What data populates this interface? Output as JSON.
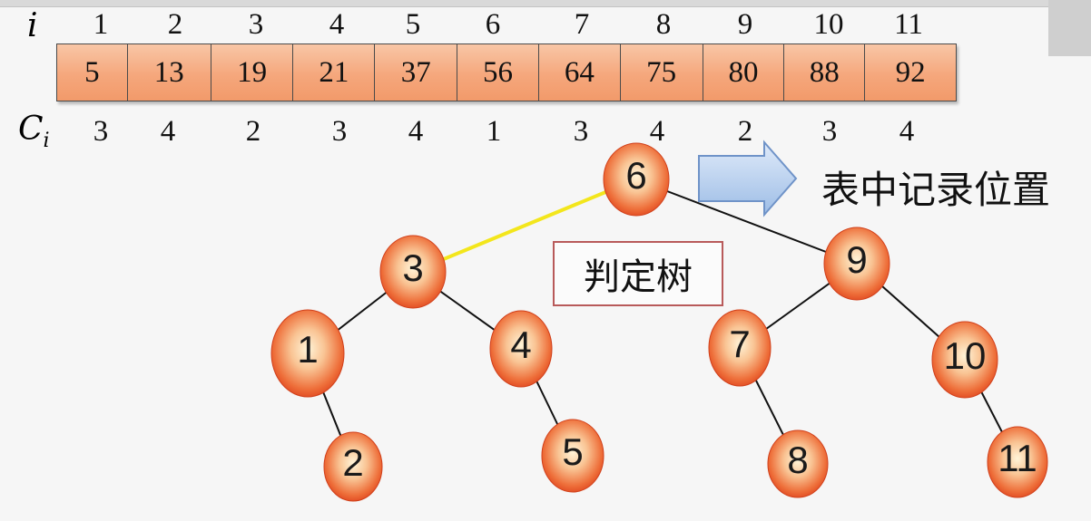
{
  "table": {
    "i_label": "i",
    "c_label": "C",
    "c_label_sub": "i",
    "indices": [
      "1",
      "2",
      "3",
      "4",
      "5",
      "6",
      "7",
      "8",
      "9",
      "10",
      "11"
    ],
    "keys": [
      "5",
      "13",
      "19",
      "21",
      "37",
      "56",
      "64",
      "75",
      "80",
      "88",
      "92"
    ],
    "costs": [
      "3",
      "4",
      "2",
      "3",
      "4",
      "1",
      "3",
      "4",
      "2",
      "3",
      "4"
    ]
  },
  "tree": {
    "nodes": [
      {
        "label": "6",
        "depth": 1
      },
      {
        "label": "3",
        "depth": 2
      },
      {
        "label": "9",
        "depth": 2
      },
      {
        "label": "1",
        "depth": 3
      },
      {
        "label": "4",
        "depth": 3
      },
      {
        "label": "7",
        "depth": 3
      },
      {
        "label": "10",
        "depth": 3
      },
      {
        "label": "2",
        "depth": 4
      },
      {
        "label": "5",
        "depth": 4
      },
      {
        "label": "8",
        "depth": 4
      },
      {
        "label": "11",
        "depth": 4
      }
    ],
    "edges": [
      {
        "from": "6",
        "to": "3",
        "highlight": true
      },
      {
        "from": "6",
        "to": "9",
        "highlight": false
      },
      {
        "from": "3",
        "to": "1",
        "highlight": false
      },
      {
        "from": "3",
        "to": "4",
        "highlight": false
      },
      {
        "from": "1",
        "to": "2",
        "highlight": false
      },
      {
        "from": "4",
        "to": "5",
        "highlight": false
      },
      {
        "from": "9",
        "to": "7",
        "highlight": false
      },
      {
        "from": "9",
        "to": "10",
        "highlight": false
      },
      {
        "from": "7",
        "to": "8",
        "highlight": false
      },
      {
        "from": "10",
        "to": "11",
        "highlight": false
      }
    ],
    "tree_label": "判定树",
    "arrow_caption": "表中记录位置"
  },
  "colors": {
    "table_fill": "#f5a77c",
    "node_fill_center": "#fff3d6",
    "node_fill_edge": "#e8542a",
    "highlight_edge": "#f3e61c",
    "edge": "#111111",
    "arrow_fill": "#a9c6ea",
    "label_box_border": "#b85a5a"
  }
}
